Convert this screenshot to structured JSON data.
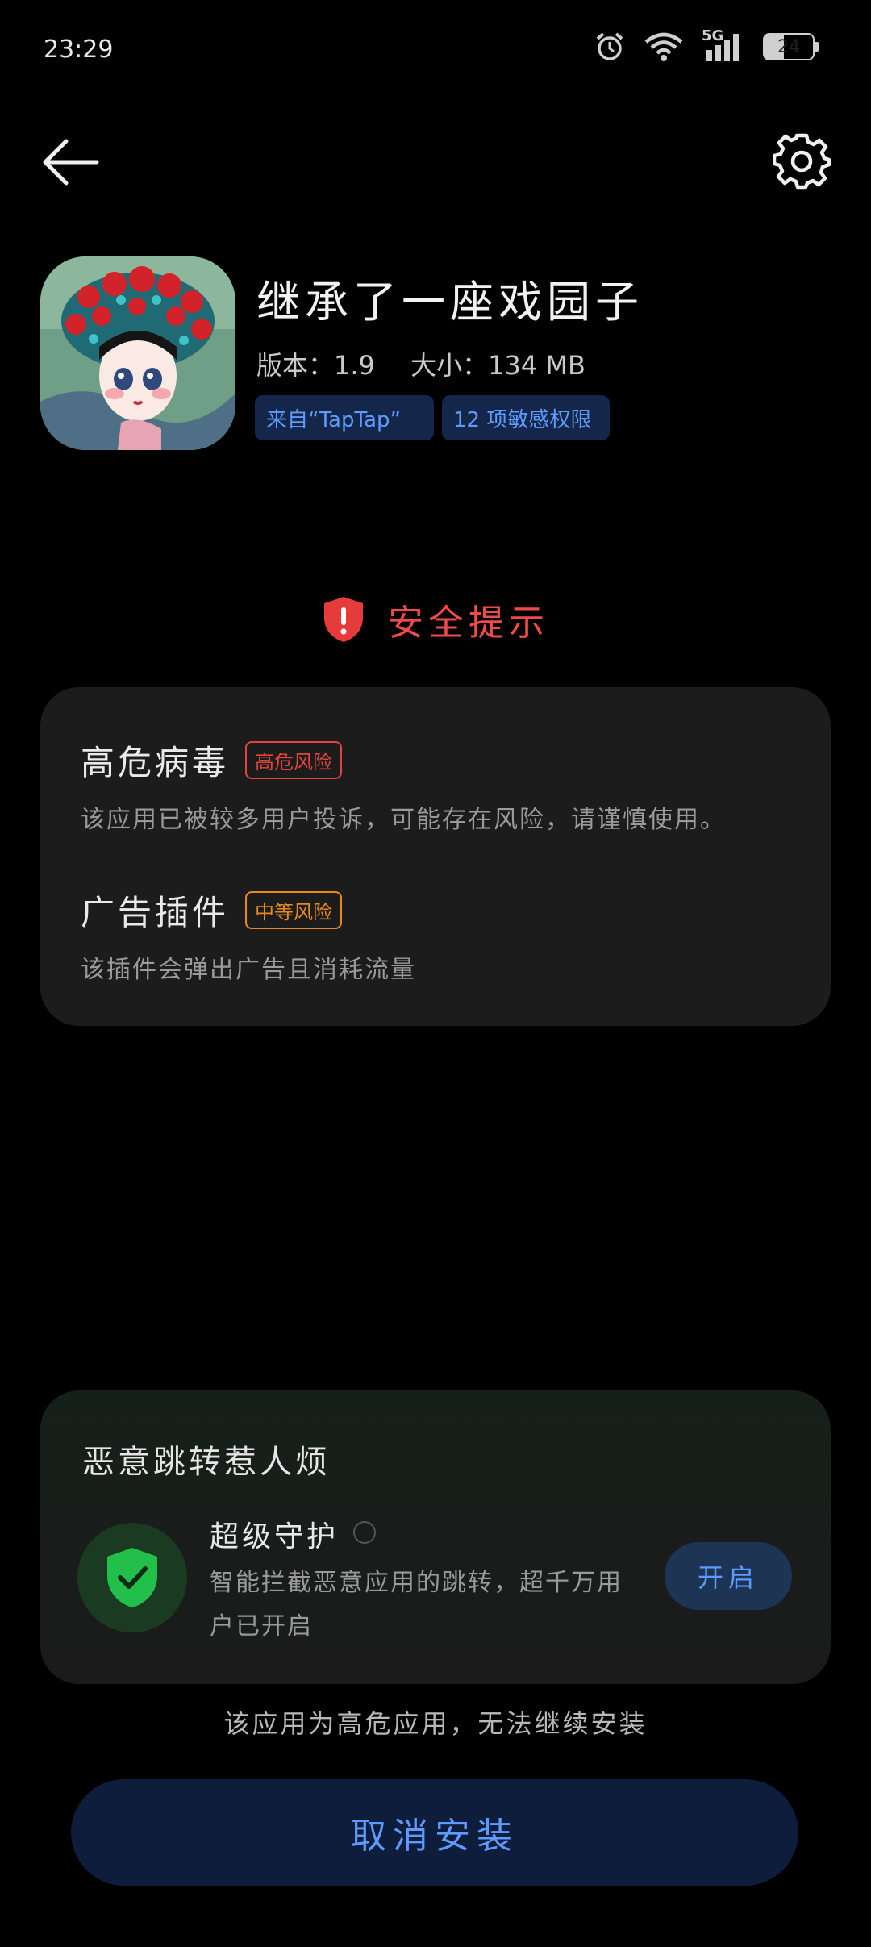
{
  "status_bar": {
    "time": "23:29",
    "network": "5G",
    "battery": "24"
  },
  "app": {
    "name": "继承了一座戏园子",
    "version": "版本：1.9",
    "size": "大小：134 MB",
    "source_chip": "来自“TapTap”",
    "permissions_chip": "12 项敏感权限"
  },
  "notice": {
    "title": "安全提示"
  },
  "risks": [
    {
      "title": "高危病毒",
      "badge": "高危风险",
      "badge_color": "#e0443e",
      "description": "该应用已被较多用户投诉，可能存在风险，请谨慎使用。"
    },
    {
      "title": "广告插件",
      "badge": "中等风险",
      "badge_color": "#e88a1a",
      "description": "该插件会弹出广告且消耗流量"
    }
  ],
  "guard": {
    "heading": "恶意跳转惹人烦",
    "name": "超级守护",
    "description": "智能拦截恶意应用的跳转，超千万用户已开启",
    "button": "开启"
  },
  "footer": {
    "warning": "该应用为高危应用，无法继续安装",
    "cancel_button": "取消安装"
  },
  "colors": {
    "accent_blue": "#5d9bff",
    "danger_red": "#f04a4a",
    "guard_green": "#22c04a"
  }
}
